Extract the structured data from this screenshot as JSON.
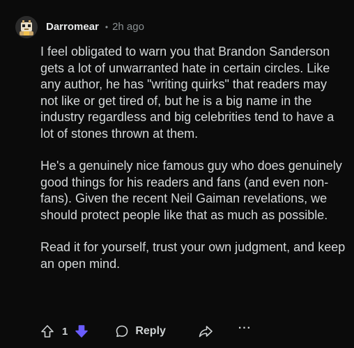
{
  "comment": {
    "username": "Darromear",
    "separator": "•",
    "time_ago": "2h ago",
    "paragraphs": [
      "I feel obligated to warn you that Brandon Sanderson gets a lot of unwarranted hate in certain circles. Like any author, he has \"writing quirks\" that readers may not like or get tired of, but he is a big name in the industry regardless and big celebrities tend to have a lot of stones thrown at them.",
      "He's a genuinely nice famous guy who does genuinely good things for his readers and fans (and even non-fans). Given the recent Neil Gaiman revelations, we should protect people like that as much as possible.",
      "Read it for yourself, trust your own judgment, and keep an open mind."
    ],
    "vote_count": "1",
    "reply_label": "Reply",
    "more_label": "···"
  },
  "icons": {
    "avatar": "snoo-avatar-icon",
    "upvote": "upvote-arrow-icon",
    "downvote": "downvote-arrow-icon",
    "reply": "speech-bubble-icon",
    "share": "share-arrow-icon"
  },
  "colors": {
    "background": "#0b0b0b",
    "text": "#d4d8d9",
    "meta": "#8b9193",
    "downvote_active": "#6a5cff"
  }
}
